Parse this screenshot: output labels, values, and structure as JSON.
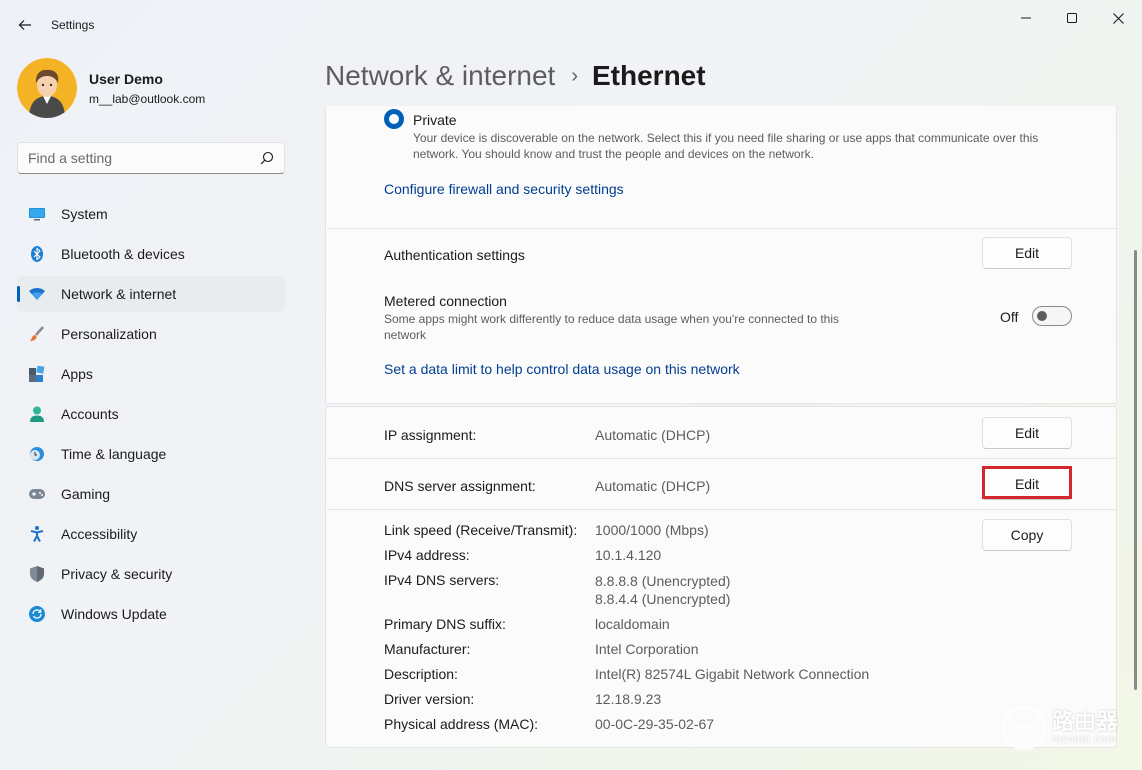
{
  "window": {
    "title": "Settings",
    "controls": [
      "minimize",
      "maximize",
      "close"
    ]
  },
  "profile": {
    "name": "User Demo",
    "email": "m__lab@outlook.com"
  },
  "search": {
    "placeholder": "Find a setting"
  },
  "sidebar": {
    "items": [
      {
        "label": "System",
        "icon": "monitor-icon"
      },
      {
        "label": "Bluetooth & devices",
        "icon": "bluetooth-icon"
      },
      {
        "label": "Network & internet",
        "icon": "wifi-icon",
        "active": true
      },
      {
        "label": "Personalization",
        "icon": "brush-icon"
      },
      {
        "label": "Apps",
        "icon": "apps-icon"
      },
      {
        "label": "Accounts",
        "icon": "person-icon"
      },
      {
        "label": "Time & language",
        "icon": "clock-globe-icon"
      },
      {
        "label": "Gaming",
        "icon": "gamepad-icon"
      },
      {
        "label": "Accessibility",
        "icon": "accessibility-icon"
      },
      {
        "label": "Privacy & security",
        "icon": "shield-icon"
      },
      {
        "label": "Windows Update",
        "icon": "update-icon"
      }
    ]
  },
  "header": {
    "parent": "Network & internet",
    "separator": "›",
    "current": "Ethernet"
  },
  "network_profile": {
    "label": "Private",
    "selected": true,
    "description": "Your device is discoverable on the network. Select this if you need file sharing or use apps that communicate over this network. You should know and trust the people and devices on the network.",
    "firewall_link": "Configure firewall and security settings"
  },
  "auth": {
    "label": "Authentication settings",
    "button": "Edit"
  },
  "metered": {
    "label": "Metered connection",
    "description": "Some apps might work differently to reduce data usage when you're connected to this network",
    "state": "Off",
    "data_limit_link": "Set a data limit to help control data usage on this network"
  },
  "ip": {
    "label": "IP assignment:",
    "value": "Automatic (DHCP)",
    "button": "Edit"
  },
  "dns": {
    "label": "DNS server assignment:",
    "value": "Automatic (DHCP)",
    "button": "Edit"
  },
  "properties": {
    "copy_button": "Copy",
    "link_speed_label": "Link speed (Receive/Transmit):",
    "link_speed": "1000/1000 (Mbps)",
    "ipv4_label": "IPv4 address:",
    "ipv4": "10.1.4.120",
    "dns_servers_label": "IPv4 DNS servers:",
    "dns_server_1": "8.8.8.8 (Unencrypted)",
    "dns_server_2": "8.8.4.4 (Unencrypted)",
    "suffix_label": "Primary DNS suffix:",
    "suffix": "localdomain",
    "manufacturer_label": "Manufacturer:",
    "manufacturer": "Intel Corporation",
    "description_label": "Description:",
    "description": "Intel(R) 82574L Gigabit Network Connection",
    "driver_label": "Driver version:",
    "driver": "12.18.9.23",
    "mac_label": "Physical address (MAC):",
    "mac": "00-0C-29-35-02-67"
  },
  "watermark": {
    "main": "路由器",
    "sub": "luyouqi.com"
  },
  "colors": {
    "accent": "#005fb8",
    "link": "#003e92",
    "highlight": "#d5282e"
  }
}
